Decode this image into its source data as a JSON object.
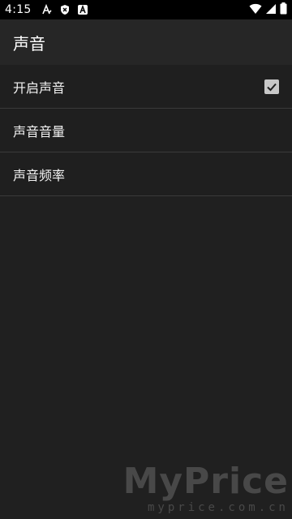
{
  "status_bar": {
    "time": "4:15",
    "notification_icons": [
      "autofill-a-icon",
      "shield-icon",
      "a-badge-icon"
    ],
    "system_icons": [
      "wifi-icon",
      "cellular-signal-icon",
      "battery-icon"
    ]
  },
  "app_bar": {
    "title": "声音"
  },
  "preferences": [
    {
      "label": "开启声音",
      "type": "checkbox",
      "checked": true
    },
    {
      "label": "声音音量",
      "type": "item"
    },
    {
      "label": "声音频率",
      "type": "item"
    }
  ],
  "watermark": {
    "main": "MyPrice",
    "sub": "myprice.com.cn"
  },
  "colors": {
    "background": "#1f1f1f",
    "app_bar": "#262626",
    "status_bar": "#000000",
    "divider": "#3a3a3a",
    "checkbox_fill": "#c8c8c8"
  }
}
